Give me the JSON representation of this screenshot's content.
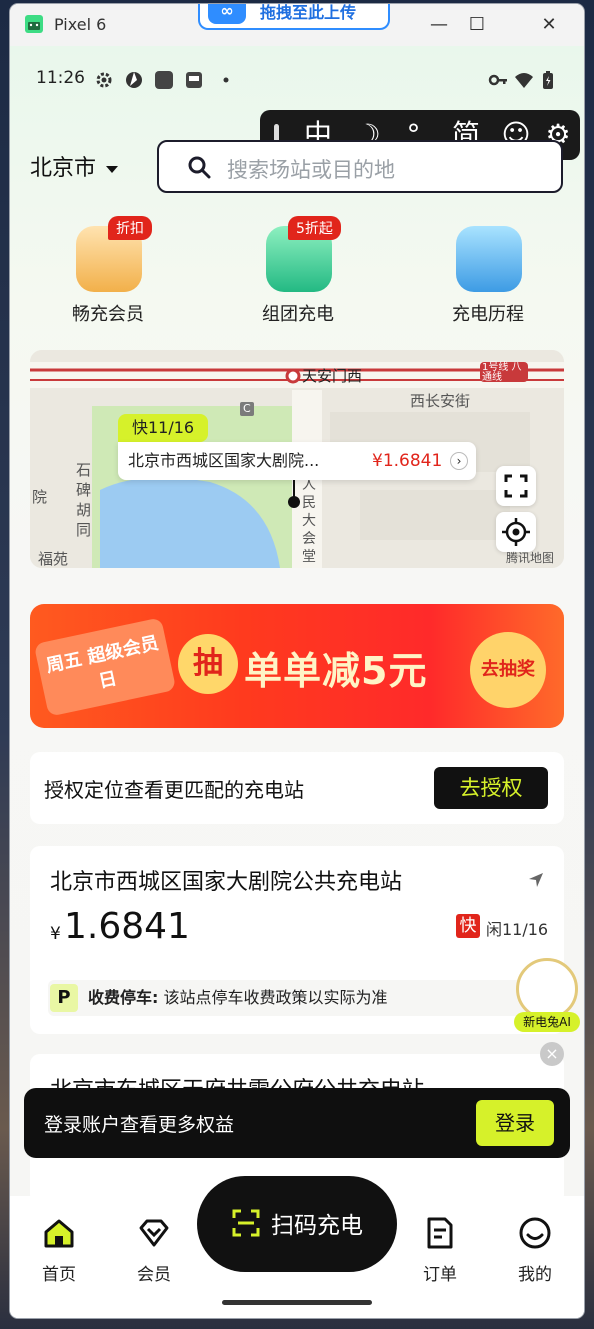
{
  "window": {
    "title": "Pixel 6",
    "upload_badge": "拖拽至此上传",
    "minimize": "—",
    "maximize": "☐",
    "close": "✕"
  },
  "statusbar": {
    "time": "11:26"
  },
  "ime": {
    "items": [
      "中",
      "☽",
      "°,",
      "简",
      "☺",
      "⚙"
    ]
  },
  "header": {
    "city": "北京市",
    "search_placeholder": "搜索场站或目的地"
  },
  "quick": [
    {
      "label": "畅充会员",
      "badge": "折扣"
    },
    {
      "label": "组团充电",
      "badge": "5折起"
    },
    {
      "label": "充电历程",
      "badge": ""
    }
  ],
  "map": {
    "labels": [
      "天安门西",
      "西长安街",
      "石碑胡同",
      "院",
      "福苑",
      "人民大会堂西路",
      "1号线 八通线",
      "C"
    ],
    "pin_tag": "快11/16",
    "pin_name": "北京市西城区国家大剧院...",
    "pin_price": "¥1.6841",
    "brand": "腾讯地图"
  },
  "promo": {
    "card_text": "周五 超级会员日",
    "draw": "抽",
    "headline": "单单减5元",
    "button": "去抽奖"
  },
  "auth": {
    "text": "授权定位查看更匹配的充电站",
    "button": "去授权"
  },
  "station": {
    "name": "北京市西城区国家大剧院公共充电站",
    "currency": "¥",
    "price": "1.6841",
    "fast": "快",
    "idle": "闲11/16",
    "park_badge": "P",
    "park_label": "收费停车:",
    "park_text": "该站点停车收费政策以实际为准"
  },
  "ai": {
    "label": "新电兔AI"
  },
  "close_x": "×",
  "station2": {
    "name": "北京市东城区天府井雪公府公共充电站"
  },
  "toast": {
    "text": "登录账户查看更多权益",
    "button": "登录"
  },
  "nav": {
    "home": "首页",
    "member": "会员",
    "scan": "扫码充电",
    "orders": "订单",
    "mine": "我的"
  },
  "colors": {
    "accent": "#d6f12a",
    "red": "#e1251b",
    "dark": "#111111"
  }
}
